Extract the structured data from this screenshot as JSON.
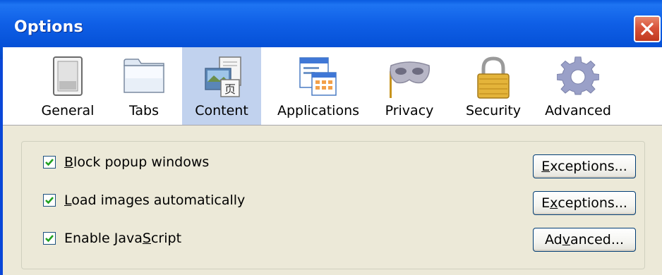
{
  "window": {
    "title": "Options"
  },
  "tabs": [
    {
      "id": "general",
      "label": "General",
      "icon": "switch-icon",
      "selected": false
    },
    {
      "id": "tabs",
      "label": "Tabs",
      "icon": "folder-tabs-icon",
      "selected": false
    },
    {
      "id": "content",
      "label": "Content",
      "icon": "content-pictures-icon",
      "selected": true
    },
    {
      "id": "applications",
      "label": "Applications",
      "icon": "applications-window-icon",
      "selected": false
    },
    {
      "id": "privacy",
      "label": "Privacy",
      "icon": "mask-icon",
      "selected": false
    },
    {
      "id": "security",
      "label": "Security",
      "icon": "padlock-icon",
      "selected": false
    },
    {
      "id": "advanced",
      "label": "Advanced",
      "icon": "gear-icon",
      "selected": false
    }
  ],
  "content": {
    "options": [
      {
        "checked": true,
        "label_pre": "",
        "label_key": "B",
        "label_post": "lock popup windows",
        "button": {
          "pre": "",
          "key": "E",
          "post": "xceptions..."
        }
      },
      {
        "checked": true,
        "label_pre": "",
        "label_key": "L",
        "label_post": "oad images automatically",
        "button": {
          "pre": "E",
          "key": "x",
          "post": "ceptions..."
        }
      },
      {
        "checked": true,
        "label_pre": "Enable Java",
        "label_key": "S",
        "label_post": "cript",
        "button": {
          "pre": "Ad",
          "key": "v",
          "post": "anced..."
        }
      }
    ]
  },
  "colors": {
    "titlebar": "#0550d6",
    "selected_tab": "#c1d2ee",
    "dialog_bg": "#ece9d8",
    "close_button": "#d8533a"
  }
}
